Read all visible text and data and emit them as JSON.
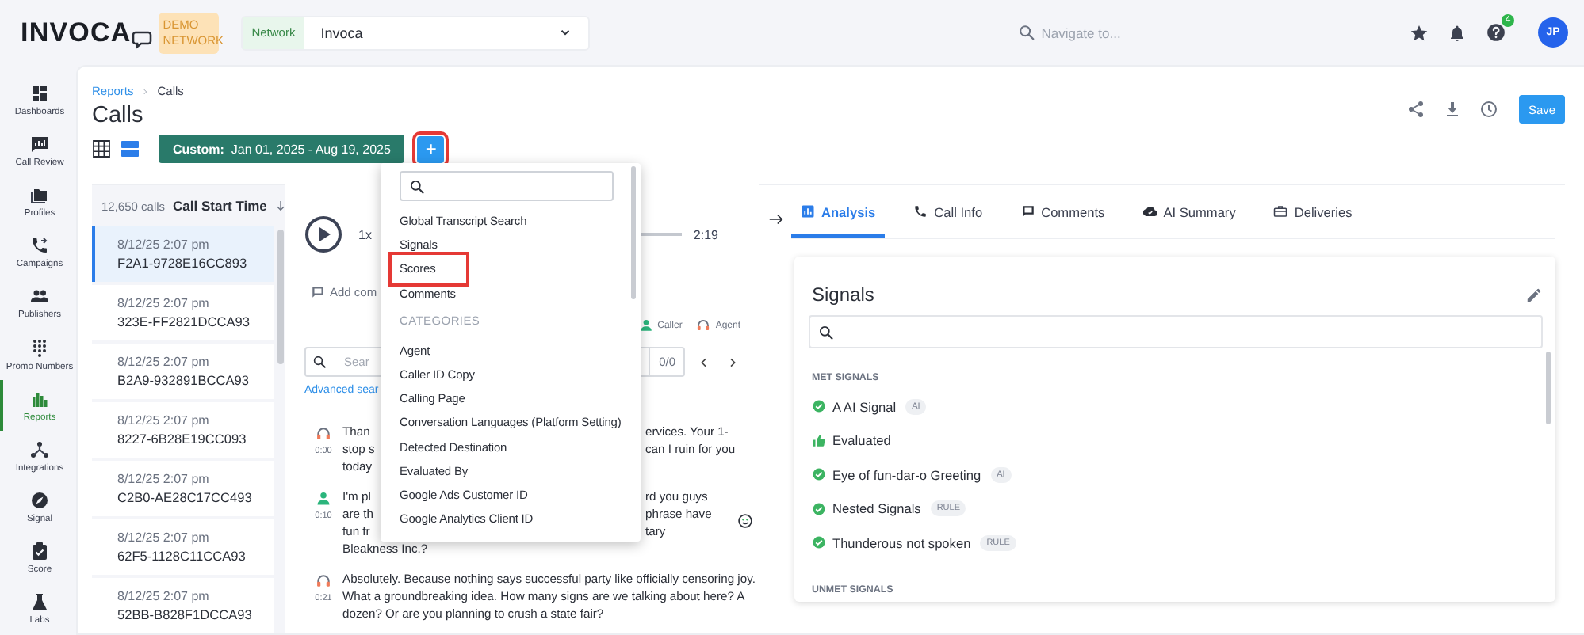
{
  "topbar": {
    "logo": "INVOCA",
    "badge": "DEMO NETWORK",
    "network_label": "Network",
    "network_value": "Invoca",
    "search_placeholder": "Navigate to...",
    "help_count": "4",
    "avatar": "JP"
  },
  "sidebar": {
    "items": [
      {
        "kind": "dashboards",
        "label": "Dashboards",
        "selected": false
      },
      {
        "kind": "review",
        "label": "Call Review",
        "selected": false
      },
      {
        "kind": "profiles",
        "label": "Profiles",
        "selected": false
      },
      {
        "kind": "campaigns",
        "label": "Campaigns",
        "selected": false
      },
      {
        "kind": "publishers",
        "label": "Publishers",
        "selected": false
      },
      {
        "kind": "numbers",
        "label": "Promo Numbers",
        "selected": false
      },
      {
        "kind": "reports",
        "label": "Reports",
        "selected": true
      },
      {
        "kind": "integrations",
        "label": "Integrations",
        "selected": false
      },
      {
        "kind": "signal",
        "label": "Signal",
        "selected": false
      },
      {
        "kind": "score",
        "label": "Score",
        "selected": false
      },
      {
        "kind": "labs",
        "label": "Labs",
        "selected": false
      }
    ]
  },
  "breadcrumb": [
    "Reports",
    "Calls"
  ],
  "title": "Calls",
  "date_range": "**Custom:**  Jan 01, 2025 - Aug 19, 2025",
  "add_button": {
    "label": "+",
    "highlighted": true
  },
  "save_button": "Save",
  "call_list": {
    "count": "12,650 calls",
    "sort_label": "Call Start Time",
    "rows": [
      {
        "time": "8/12/25 2:07 pm",
        "id": "F2A1-9728E16CC893",
        "selected": true
      },
      {
        "time": "8/12/25 2:07 pm",
        "id": "323E-FF2821DCCA93",
        "selected": false
      },
      {
        "time": "8/12/25 2:07 pm",
        "id": "B2A9-932891BCCA93",
        "selected": false
      },
      {
        "time": "8/12/25 2:07 pm",
        "id": "8227-6B28E19CC093",
        "selected": false
      },
      {
        "time": "8/12/25 2:07 pm",
        "id": "C2B0-AE28C17CC493",
        "selected": false
      },
      {
        "time": "8/12/25 2:07 pm",
        "id": "62F5-1128C11CCA93",
        "selected": false
      },
      {
        "time": "8/12/25 2:07 pm",
        "id": "52BB-B828F1DCCA93",
        "selected": false
      }
    ]
  },
  "player": {
    "speed": "1x",
    "duration": "2:19",
    "add_comment": "Add com",
    "legend": [
      {
        "kind": "caller",
        "label": "Caller"
      },
      {
        "kind": "agent",
        "label": "Agent"
      }
    ],
    "search_placeholder": "Sear",
    "match_count": "0/0",
    "advanced_search": "Advanced sear",
    "messages": [
      {
        "kind": "agent",
        "time": "0:00",
        "positive_sentiment": false,
        "lines": [
          {
            "left": "Than",
            "right": "ervices. Your 1-"
          },
          {
            "left": "stop s",
            "right": "can I ruin for you"
          },
          {
            "left": "today"
          }
        ]
      },
      {
        "kind": "caller",
        "time": "0:10",
        "positive_sentiment": true,
        "lines": [
          {
            "left": "I'm pl",
            "right": "rd you guys"
          },
          {
            "left": "are th",
            "right": "phrase have"
          },
          {
            "left": "fun fr",
            "right": "tary"
          },
          {
            "text": "Bleakness Inc.?"
          }
        ]
      },
      {
        "kind": "agent",
        "time": "0:21",
        "positive_sentiment": false,
        "lines": [
          {
            "text": "Absolutely. Because nothing says successful party like officially censoring joy. What a groundbreaking idea. How many signs are we talking about here? A dozen? Or are you planning to crush a state fair?"
          }
        ]
      }
    ]
  },
  "add_menu": {
    "items": [
      {
        "kind": "item",
        "label": "Global Transcript Search",
        "highlighted": false
      },
      {
        "kind": "item",
        "label": "Signals",
        "highlighted": false
      },
      {
        "kind": "item",
        "label": "Scores",
        "highlighted": true
      },
      {
        "kind": "item",
        "label": "Comments",
        "highlighted": false
      },
      {
        "kind": "heading",
        "label": "CATEGORIES"
      },
      {
        "kind": "item",
        "label": "Agent",
        "highlighted": false
      },
      {
        "kind": "item",
        "label": "Caller ID Copy",
        "highlighted": false
      },
      {
        "kind": "item",
        "label": "Calling Page",
        "highlighted": false
      },
      {
        "kind": "item",
        "label": "Conversation Languages (Platform Setting)",
        "highlighted": false
      },
      {
        "kind": "item",
        "label": "Detected Destination",
        "highlighted": false
      },
      {
        "kind": "item",
        "label": "Evaluated By",
        "highlighted": false
      },
      {
        "kind": "item",
        "label": "Google Ads Customer ID",
        "highlighted": false
      },
      {
        "kind": "item",
        "label": "Google Analytics Client ID",
        "highlighted": false
      }
    ]
  },
  "detail": {
    "tabs": [
      {
        "kind": "analysis",
        "label": "Analysis",
        "selected": true
      },
      {
        "kind": "info",
        "label": "Call Info",
        "selected": false
      },
      {
        "kind": "comments",
        "label": "Comments",
        "selected": false
      },
      {
        "kind": "summary",
        "label": "AI Summary",
        "selected": false
      },
      {
        "kind": "deliveries",
        "label": "Deliveries",
        "selected": false
      }
    ],
    "signals": {
      "title": "Signals",
      "groups": [
        {
          "heading": "MET SIGNALS",
          "items": [
            {
              "kind": "check",
              "label": "A AI Signal",
              "badge": "AI"
            },
            {
              "kind": "thumb",
              "label": "Evaluated"
            },
            {
              "kind": "check",
              "label": "Eye of fun-dar-o Greeting",
              "badge": "AI"
            },
            {
              "kind": "check",
              "label": "Nested Signals",
              "badge": "RULE"
            },
            {
              "kind": "check",
              "label": "Thunderous not spoken",
              "badge": "RULE"
            }
          ]
        },
        {
          "heading": "UNMET SIGNALS"
        }
      ]
    }
  }
}
